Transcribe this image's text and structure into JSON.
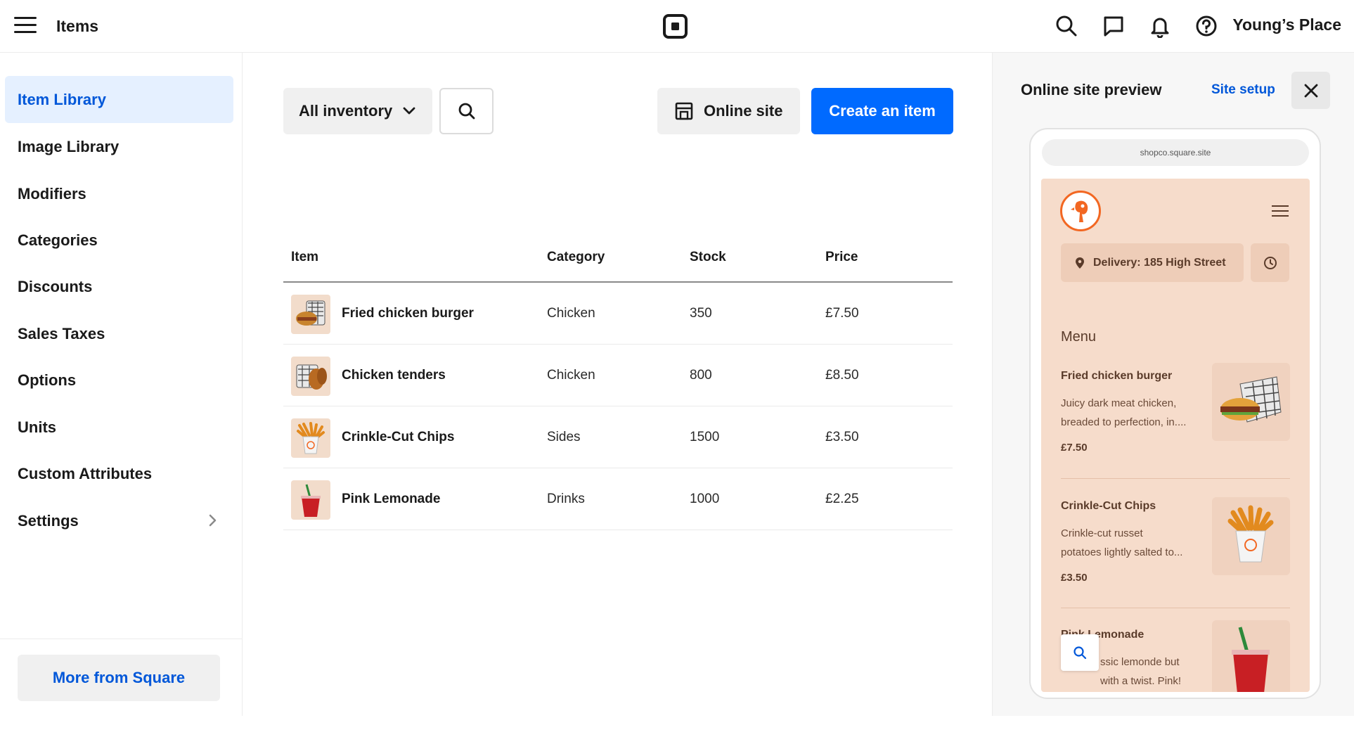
{
  "topbar": {
    "title": "Items",
    "store_name": "Young’s Place",
    "icons": [
      "menu-icon",
      "square-logo-icon",
      "search-icon",
      "messages-icon",
      "bell-icon",
      "help-icon"
    ]
  },
  "sidebar": {
    "items": [
      {
        "label": "Item Library",
        "active": true
      },
      {
        "label": "Image Library"
      },
      {
        "label": "Modifiers"
      },
      {
        "label": "Categories"
      },
      {
        "label": "Discounts"
      },
      {
        "label": "Sales Taxes"
      },
      {
        "label": "Options"
      },
      {
        "label": "Units"
      },
      {
        "label": "Custom Attributes"
      },
      {
        "label": "Settings"
      }
    ],
    "footer_button": "More from Square"
  },
  "toolbar": {
    "filter_label": "All inventory",
    "online_site_label": "Online site",
    "create_label": "Create an item"
  },
  "table": {
    "headers": {
      "item": "Item",
      "category": "Category",
      "stock": "Stock",
      "price": "Price"
    },
    "rows": [
      {
        "name": "Fried chicken burger",
        "category": "Chicken",
        "stock": "350",
        "price": "£7.50"
      },
      {
        "name": "Chicken tenders",
        "category": "Chicken",
        "stock": "800",
        "price": "£8.50"
      },
      {
        "name": "Crinkle-Cut Chips",
        "category": "Sides",
        "stock": "1500",
        "price": "£3.50"
      },
      {
        "name": "Pink Lemonade",
        "category": "Drinks",
        "stock": "1000",
        "price": "£2.25"
      }
    ]
  },
  "preview": {
    "title": "Online site preview",
    "setup_link": "Site setup",
    "url": "shopco.square.site",
    "delivery": "Delivery: 185 High Street",
    "menu_heading": "Menu",
    "menu_items": [
      {
        "name": "Fried chicken burger",
        "desc": "Juicy dark meat chicken,\nbreaded to perfection, in....",
        "price": "£7.50"
      },
      {
        "name": "Crinkle-Cut Chips",
        "desc": "Crinkle-cut russet\npotatoes lightly salted to...",
        "price": "£3.50"
      },
      {
        "name": "Pink Lemonade",
        "desc": "ssic lemonde but\nwith a twist. Pink!",
        "price": ""
      }
    ]
  },
  "colors": {
    "accent": "#006aff",
    "link": "#0057d9",
    "active_bg": "#e5f0ff",
    "site_bg": "#f6dccb",
    "brand_orange": "#f26722"
  }
}
